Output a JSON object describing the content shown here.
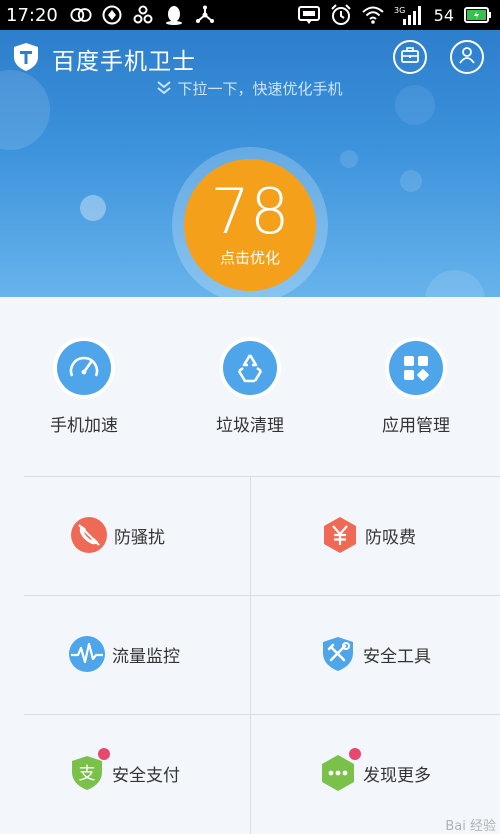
{
  "status_bar": {
    "time": "17:20",
    "network": "3G",
    "battery": "54",
    "icons_left": [
      "circles-icon",
      "sync-icon",
      "share-icon",
      "qq-penguin-icon",
      "network-icon"
    ],
    "icons_right": [
      "message-icon",
      "alarm-icon",
      "wifi-icon",
      "signal-icon",
      "battery-icon"
    ]
  },
  "header": {
    "app_title": "百度手机卫士",
    "pull_hint": "下拉一下，快速优化手机",
    "colors": {
      "hero_top": "#2d7ecc",
      "hero_bottom": "#67b3ec"
    }
  },
  "score": {
    "value": "78",
    "action": "点击优化",
    "color": "#f4a01a"
  },
  "quick_actions": [
    {
      "label": "手机加速",
      "icon": "speedometer-icon"
    },
    {
      "label": "垃圾清理",
      "icon": "recycle-icon"
    },
    {
      "label": "应用管理",
      "icon": "apps-grid-icon"
    }
  ],
  "features": [
    {
      "label": "防骚扰",
      "icon": "phone-block-icon",
      "color": "#ee6a55"
    },
    {
      "label": "防吸费",
      "icon": "yuan-hexagon-icon",
      "color": "#ee6a55"
    },
    {
      "label": "流量监控",
      "icon": "pulse-icon",
      "color": "#4ea5ea"
    },
    {
      "label": "安全工具",
      "icon": "shield-tools-icon",
      "color": "#4ea5ea"
    },
    {
      "label": "安全支付",
      "icon": "shield-pay-icon",
      "color": "#79c148",
      "badge": "支"
    },
    {
      "label": "发现更多",
      "icon": "more-hexagon-icon",
      "color": "#79c148"
    }
  ],
  "watermark": "Bai 经验"
}
